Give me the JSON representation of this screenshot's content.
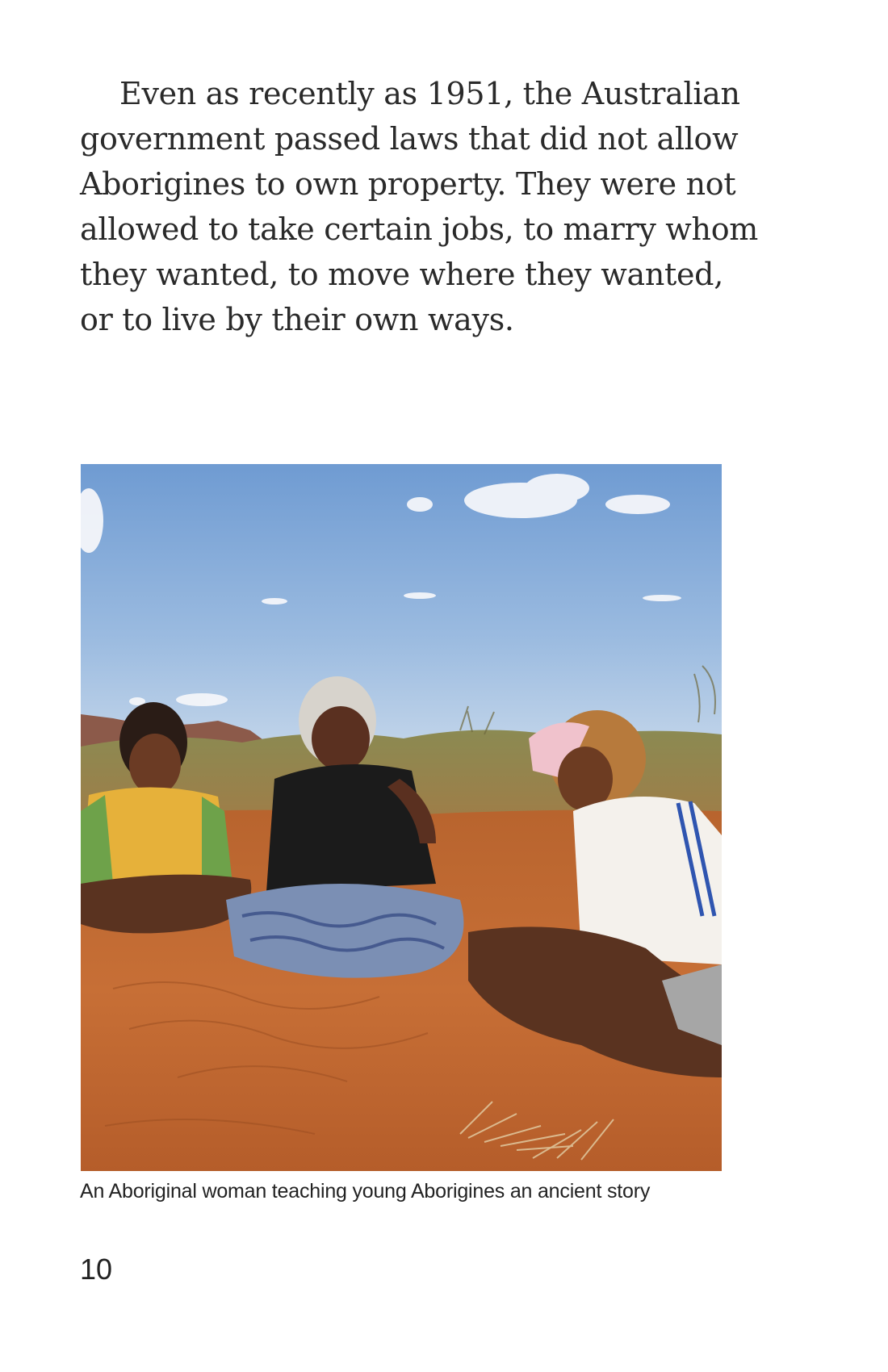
{
  "paragraph": {
    "lines": [
      "Even as recently as 1951, the Australian",
      "government passed laws that did not allow",
      "Aborigines to own property. They were not",
      "allowed to take certain jobs, to marry whom",
      "they wanted, to move where they wanted,",
      "or to live by their own ways."
    ]
  },
  "figure": {
    "caption": "An Aboriginal woman teaching young Aborigines an ancient story"
  },
  "page_number": "10"
}
